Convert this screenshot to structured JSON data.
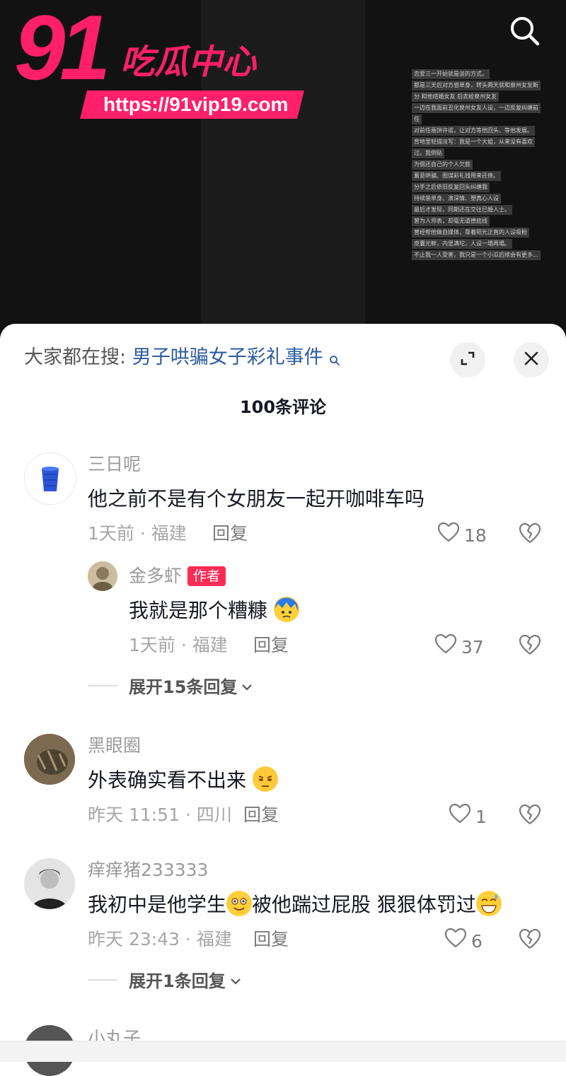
{
  "video": {
    "chat_lines": [
      "恋爱三一开始就是谈的方式。",
      "都是三天后对方感单身，转头两天就和泉州女友断",
      "分 和他结婚女友 后去给泉州女友",
      "一边在我面前丑化泉州女友人设，一边反复纠缠前",
      "任",
      "对前任画饼许诺，让对方等他回头、等他发展。",
      "背地里轻描淡写：我是一个大姐，从来没有喜欢",
      "过。我倒贴",
      "为偿还自己的个人欠款",
      "蓄意哄骗、图谋彩礼钱用来还债。",
      "分手之后依旧反复回头纠缠我",
      "持续装单身、演深情、塑真心人设",
      "最后才发现，同期还在交往已婚人士。",
      "曾为人师表，却毫无道德底线",
      "曾经帮他做自媒体，靠着阳光正直的人设吸粉",
      "皮囊光鲜，内里满坨，人设一塌再塌。",
      "不止我一人受害，我只是一个小瓜后续会有更多..."
    ]
  },
  "watermark": {
    "number": "91",
    "brand": "吃瓜中心",
    "url": "https://91vip19.com"
  },
  "sheet": {
    "search_label": "大家都在搜:",
    "search_query": "男子哄骗女子彩礼事件",
    "comment_count": "100条评论",
    "reply_label": "回复"
  },
  "comments": [
    {
      "username": "三日呢",
      "text": "他之前不是有个女朋友一起开咖啡车吗",
      "meta": "1天前 · 福建",
      "likes": "18",
      "replies": [
        {
          "username": "金多虾",
          "tag": "作者",
          "text": "我就是那个糟糠",
          "meta": "1天前 · 福建",
          "likes": "37"
        }
      ],
      "expand": "展开15条回复"
    },
    {
      "username": "黑眼圈",
      "text": "外表确实看不出来",
      "meta": "昨天 11:51 · 四川",
      "likes": "1"
    },
    {
      "username": "痒痒猪233333",
      "text_part1": "我初中是他学生",
      "text_part2": "被他踹过屁股 狠狠体罚过",
      "meta": "昨天 23:43 · 福建",
      "likes": "6",
      "expand": "展开1条回复"
    }
  ],
  "next_comment_partial": "小丸子",
  "colors": {
    "accent": "#fe2c55",
    "watermark": "#ff1f6a",
    "link": "#2c5c9e"
  },
  "icons": [
    "search-icon",
    "expand-icon",
    "close-icon",
    "heart-icon",
    "broken-heart-icon",
    "chevron-down-icon"
  ]
}
